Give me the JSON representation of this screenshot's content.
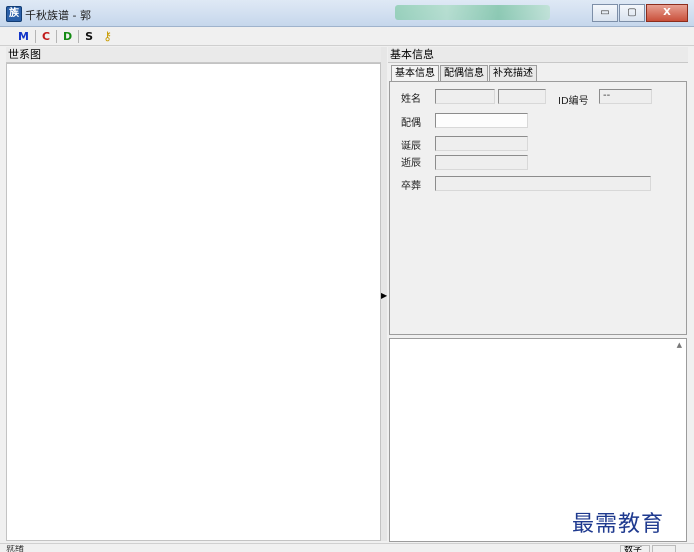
{
  "window": {
    "title": "千秋族谱 - 郭",
    "minimize_label": "▭",
    "maximize_label": "▢",
    "close_label": "X"
  },
  "toolbar": {
    "m_label": "M",
    "c_label": "C",
    "d_label": "D",
    "s_label": "S",
    "key_icon": "key-icon"
  },
  "left_panel": {
    "header": "世系图"
  },
  "right_panel": {
    "header": "基本信息",
    "tabs": [
      {
        "label": "基本信息"
      },
      {
        "label": "配偶信息"
      },
      {
        "label": "补充描述"
      }
    ],
    "fields": {
      "name_label": "姓名",
      "id_label": "ID编号",
      "id_value": "--",
      "spouse_label": "配偶",
      "birth_label": "诞辰",
      "death_label": "逝辰",
      "burial_label": "卒葬"
    }
  },
  "watermark": "最需教育",
  "statusbar": {
    "text": "就绪",
    "cell": "数字"
  },
  "colors": {
    "accent_blue": "#1335c8",
    "accent_red": "#c01818",
    "accent_green": "#138a13"
  }
}
